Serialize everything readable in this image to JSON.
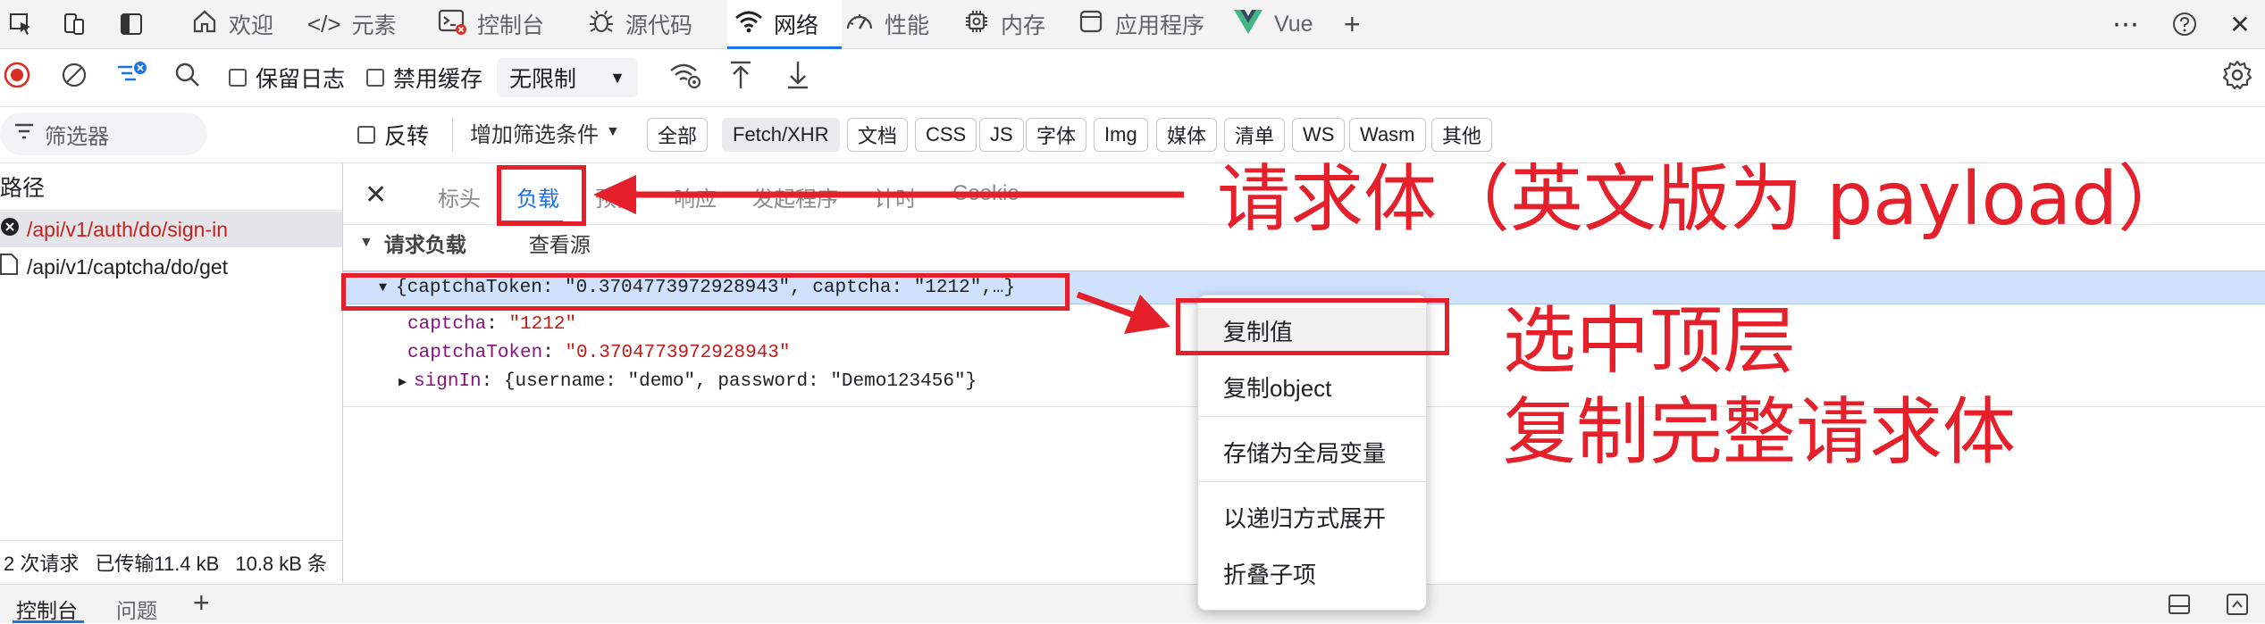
{
  "tabbar": {
    "tabs": [
      {
        "label": "欢迎",
        "icon": "home-icon"
      },
      {
        "label": "元素",
        "icon": "code-icon"
      },
      {
        "label": "控制台",
        "icon": "console-icon"
      },
      {
        "label": "源代码",
        "icon": "bug-icon"
      },
      {
        "label": "网络",
        "icon": "wifi-icon"
      },
      {
        "label": "性能",
        "icon": "gauge-icon"
      },
      {
        "label": "内存",
        "icon": "chip-icon"
      },
      {
        "label": "应用程序",
        "icon": "app-icon"
      },
      {
        "label": "Vue",
        "icon": "vue-logo-icon"
      }
    ],
    "active_tab": "网络",
    "add_label": "+"
  },
  "toolbar": {
    "preserve_log": "保留日志",
    "disable_cache": "禁用缓存",
    "throttle": "无限制"
  },
  "filter": {
    "placeholder": "筛选器",
    "invert": "反转",
    "more_filters": "增加筛选条件",
    "chips": [
      "全部",
      "Fetch/XHR",
      "文档",
      "CSS",
      "JS",
      "字体",
      "Img",
      "媒体",
      "清单",
      "WS",
      "Wasm",
      "其他"
    ],
    "selected_chip": "Fetch/XHR"
  },
  "requests": {
    "header": "路径",
    "items": [
      {
        "path": "/api/v1/auth/do/sign-in",
        "status": "error"
      },
      {
        "path": "/api/v1/captcha/do/get",
        "status": "ok"
      }
    ],
    "status": {
      "count": "2 次请求",
      "transferred": "已传输11.4 kB",
      "resources": "10.8 kB 条"
    }
  },
  "detail": {
    "tabs": [
      "标头",
      "负载",
      "预览",
      "响应",
      "发起程序",
      "计时",
      "Cookie"
    ],
    "active_tab": "负载",
    "payload_title": "请求负载",
    "view_source": "查看源",
    "summary": "{captchaToken: \"0.3704773972928943\", captcha: \"1212\",…}",
    "fields": [
      {
        "key": "captcha",
        "value": "\"1212\""
      },
      {
        "key": "captchaToken",
        "value": "\"0.3704773972928943\""
      }
    ],
    "nested": {
      "key": "signIn",
      "value": "{username: \"demo\", password: \"Demo123456\"}"
    }
  },
  "context_menu": {
    "items": [
      "复制值",
      "复制object",
      "存储为全局变量",
      "以递归方式展开",
      "折叠子项"
    ]
  },
  "drawer": {
    "tabs": [
      "控制台",
      "问题"
    ],
    "add_label": "+"
  },
  "annotations": {
    "payload_note": "请求体（英文版为 payload）",
    "select_note_1": "选中顶层",
    "select_note_2": "复制完整请求体"
  },
  "colors": {
    "accent": "#1a73e8",
    "annotation": "#e5202a",
    "selection": "#cfe1fb"
  }
}
